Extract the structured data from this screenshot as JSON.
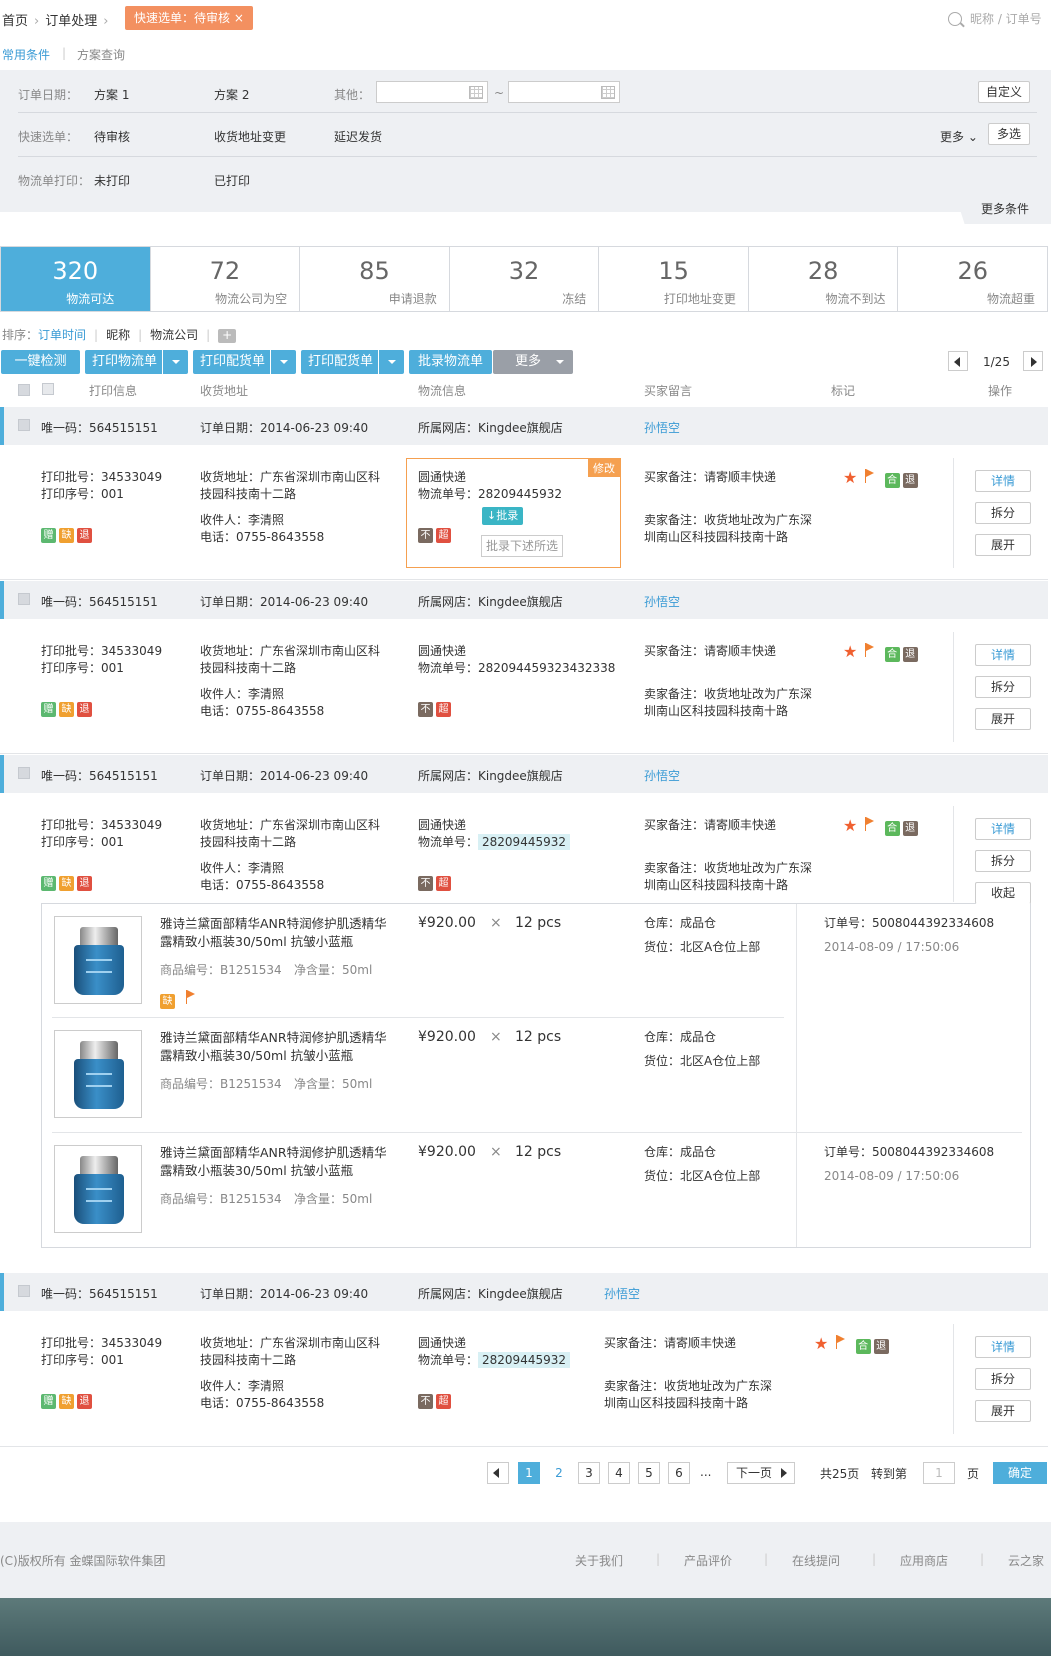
{
  "breadcrumb": {
    "home": "首页",
    "orders": "订单处理",
    "tag": "快速选单：待审核 ×"
  },
  "search": {
    "placeholder": "昵称 / 订单号"
  },
  "filter_tabs": {
    "common": "常用条件",
    "scheme": "方案查询"
  },
  "filters": {
    "order_date": {
      "label": "订单日期：",
      "opt1": "方案  1",
      "opt2": "方案  2",
      "other": "其他：",
      "tilde": "~",
      "custom": "自定义"
    },
    "quick": {
      "label": "快速选单：",
      "opt1": "待审核",
      "opt2": "收货地址变更",
      "opt3": "延迟发货",
      "more": "更多",
      "multi": "多选"
    },
    "print": {
      "label": "物流单打印：",
      "opt1": "未打印",
      "opt2": "已打印"
    },
    "more_conditions": "更多条件"
  },
  "stats": [
    {
      "num": "320",
      "label": "物流可达"
    },
    {
      "num": "72",
      "label": "物流公司为空"
    },
    {
      "num": "85",
      "label": "申请退款"
    },
    {
      "num": "32",
      "label": "冻结"
    },
    {
      "num": "15",
      "label": "打印地址变更"
    },
    {
      "num": "28",
      "label": "物流不到达"
    },
    {
      "num": "26",
      "label": "物流超重"
    }
  ],
  "sort": {
    "label": "排序：",
    "time": "订单时间",
    "nick": "昵称",
    "company": "物流公司",
    "add": "+"
  },
  "toolbar": {
    "check": "一键检测",
    "print_logistics": "打印物流单",
    "print_pick": "打印配货单",
    "print_pick2": "打印配货单",
    "batch": "批录物流单",
    "more": "更多",
    "page": "1/25"
  },
  "header": {
    "print": "打印信息",
    "address": "收货地址",
    "logistics": "物流信息",
    "message": "买家留言",
    "mark": "标记",
    "ops": "操作"
  },
  "orders": [
    {
      "uid": "唯一码：564515151",
      "date": "订单日期：2014-06-23  09:40",
      "shop": "所属网店：Kingdee旗舰店",
      "buyer": "孙悟空",
      "batch": "打印批号：34533049",
      "seq": "打印序号：001",
      "addr1": "收货地址：广东省深圳市南山区科",
      "addr2": "技园科技南十二路",
      "recv": "收件人：李清照",
      "phone": "电话：0755-8643558",
      "courier": "圆通快递",
      "track": "物流单号：28209445932",
      "buyer_note": "买家备注：请寄顺丰快递",
      "seller1": "卖家备注：收货地址改为广东深",
      "seller2": "圳南山区科技园科技南十路",
      "tags": [
        "赠",
        "缺",
        "退"
      ],
      "lt": [
        "不",
        "超"
      ],
      "marks": [
        "合",
        "退"
      ],
      "detail": "详情",
      "split": "拆分",
      "expand": "展开",
      "edit": "修改",
      "batch_btn": "批录",
      "batch_placeholder": "批录下述所选"
    },
    {
      "uid": "唯一码：564515151",
      "date": "订单日期：2014-06-23  09:40",
      "shop": "所属网店：Kingdee旗舰店",
      "buyer": "孙悟空",
      "batch": "打印批号：34533049",
      "seq": "打印序号：001",
      "addr1": "收货地址：广东省深圳市南山区科",
      "addr2": "技园科技南十二路",
      "recv": "收件人：李清照",
      "phone": "电话：0755-8643558",
      "courier": "圆通快递",
      "track": "物流单号：282094459323432338",
      "buyer_note": "买家备注：请寄顺丰快递",
      "seller1": "卖家备注：收货地址改为广东深",
      "seller2": "圳南山区科技园科技南十路",
      "tags": [
        "赠",
        "缺",
        "退"
      ],
      "lt": [
        "不",
        "超"
      ],
      "marks": [
        "合",
        "退"
      ],
      "detail": "详情",
      "split": "拆分",
      "expand": "展开"
    },
    {
      "uid": "唯一码：564515151",
      "date": "订单日期：2014-06-23  09:40",
      "shop": "所属网店：Kingdee旗舰店",
      "buyer": "孙悟空",
      "batch": "打印批号：34533049",
      "seq": "打印序号：001",
      "addr1": "收货地址：广东省深圳市南山区科",
      "addr2": "技园科技南十二路",
      "recv": "收件人：李清照",
      "phone": "电话：0755-8643558",
      "courier": "圆通快递",
      "track_label": "物流单号：",
      "track_no": "28209445932",
      "buyer_note": "买家备注：请寄顺丰快递",
      "seller1": "卖家备注：收货地址改为广东深",
      "seller2": "圳南山区科技园科技南十路",
      "tags": [
        "赠",
        "缺",
        "退"
      ],
      "lt": [
        "不",
        "超"
      ],
      "marks": [
        "合",
        "退"
      ],
      "detail": "详情",
      "split": "拆分",
      "collapse": "收起"
    },
    {
      "uid": "唯一码：564515151",
      "date": "订单日期：2014-06-23  09:40",
      "shop": "所属网店：Kingdee旗舰店",
      "buyer": "孙悟空",
      "batch": "打印批号：34533049",
      "seq": "打印序号：001",
      "addr1": "收货地址：广东省深圳市南山区科",
      "addr2": "技园科技南十二路",
      "recv": "收件人：李清照",
      "phone": "电话：0755-8643558",
      "courier": "圆通快递",
      "track_label": "物流单号：",
      "track_no": "28209445932",
      "buyer_note": "买家备注：请寄顺丰快递",
      "seller1": "卖家备注：收货地址改为广东深",
      "seller2": "圳南山区科技园科技南十路",
      "tags": [
        "赠",
        "缺",
        "退"
      ],
      "lt": [
        "不",
        "超"
      ],
      "marks": [
        "合",
        "退"
      ],
      "detail": "详情",
      "split": "拆分",
      "expand": "展开"
    }
  ],
  "products": [
    {
      "name1": "雅诗兰黛面部精华ANR特润修护肌透精华",
      "name2": "露精致小瓶装30/50ml 抗皱小蓝瓶",
      "price": "¥920.00",
      "x": "×",
      "qty": "12 pcs",
      "code": "商品编号：B1251534",
      "net": "净含量：50ml",
      "wh": "仓库：成品仓",
      "loc": "货位：北区A仓位上部",
      "tag": "缺"
    },
    {
      "name1": "雅诗兰黛面部精华ANR特润修护肌透精华",
      "name2": "露精致小瓶装30/50ml 抗皱小蓝瓶",
      "price": "¥920.00",
      "x": "×",
      "qty": "12 pcs",
      "code": "商品编号：B1251534",
      "net": "净含量：50ml",
      "wh": "仓库：成品仓",
      "loc": "货位：北区A仓位上部"
    },
    {
      "name1": "雅诗兰黛面部精华ANR特润修护肌透精华",
      "name2": "露精致小瓶装30/50ml 抗皱小蓝瓶",
      "price": "¥920.00",
      "x": "×",
      "qty": "12 pcs",
      "code": "商品编号：B1251534",
      "net": "净含量：50ml",
      "wh": "仓库：成品仓",
      "loc": "货位：北区A仓位上部"
    }
  ],
  "sub_orders": [
    {
      "no": "订单号：5008044392334608",
      "time": "2014-08-09   /   17:50:06"
    },
    {
      "no": "订单号：5008044392334608",
      "time": "2014-08-09   /   17:50:06"
    }
  ],
  "pagination": {
    "pages": [
      "1",
      "2",
      "3",
      "4",
      "5",
      "6"
    ],
    "ellipsis": "...",
    "next": "下一页",
    "total": "共25页",
    "goto": "转到第",
    "input": "1",
    "unit": "页",
    "confirm": "确定"
  },
  "footer": {
    "copyright": "(C)版权所有  金蝶国际软件集团",
    "links": [
      "关于我们",
      "产品评价",
      "在线提问",
      "应用商店",
      "云之家"
    ]
  }
}
